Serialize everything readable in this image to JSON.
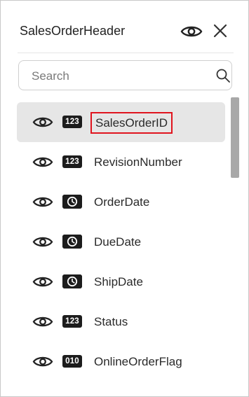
{
  "panel": {
    "title": "SalesOrderHeader",
    "header_icons": [
      "eye-icon",
      "close-icon"
    ]
  },
  "search": {
    "placeholder": "Search",
    "value": "",
    "icon": "search-icon"
  },
  "columns": [
    {
      "label": "SalesOrderID",
      "type": "123",
      "selected": true
    },
    {
      "label": "RevisionNumber",
      "type": "123",
      "selected": false
    },
    {
      "label": "OrderDate",
      "type": "clock",
      "selected": false
    },
    {
      "label": "DueDate",
      "type": "clock",
      "selected": false
    },
    {
      "label": "ShipDate",
      "type": "clock",
      "selected": false
    },
    {
      "label": "Status",
      "type": "123",
      "selected": false
    },
    {
      "label": "OnlineOrderFlag",
      "type": "010",
      "selected": false
    }
  ],
  "colors": {
    "selected_row": "#e6e6e6",
    "highlight_border": "#e0141e",
    "badge_bg": "#1c1c1c"
  }
}
